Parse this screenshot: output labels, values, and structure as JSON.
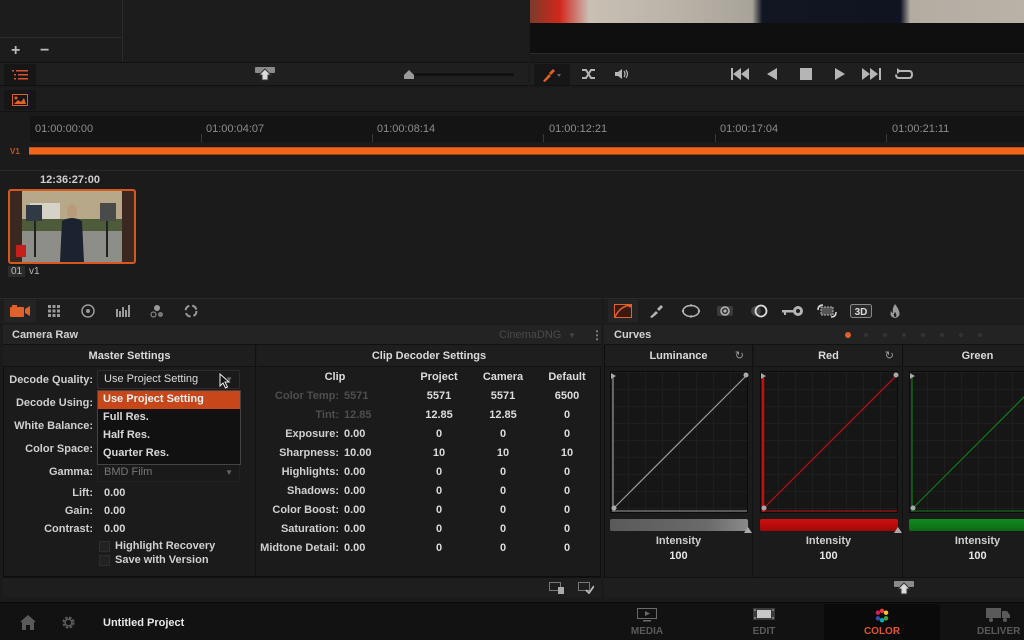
{
  "media_pool": {
    "add_label": "+",
    "remove_label": "−"
  },
  "viewer_controls": {
    "icons": [
      "eyedropper-icon",
      "shuffle-icon",
      "volume-icon",
      "skip-back-icon",
      "play-reverse-icon",
      "stop-icon",
      "play-icon",
      "skip-forward-icon",
      "loop-icon"
    ]
  },
  "timeline": {
    "timecodes": [
      "01:00:00:00",
      "01:00:04:07",
      "01:00:08:14",
      "01:00:12:21",
      "01:00:17:04",
      "01:00:21:11"
    ],
    "track_label": "V1"
  },
  "clip": {
    "timecode": "12:36:27:00",
    "number": "01",
    "track": "v1"
  },
  "left_palette_icons": [
    "camera-raw-icon",
    "grid-icon",
    "primaries-icon",
    "rgb-mixer-icon",
    "nodes-icon",
    "motion-icon"
  ],
  "right_palette_icons": [
    "curves-icon",
    "qualifier-icon",
    "window-icon",
    "tracker-icon",
    "blur-icon",
    "key-icon",
    "sizing-icon",
    "3d-icon",
    "fire-icon"
  ],
  "camera_raw": {
    "title": "Camera Raw",
    "codec": "CinemaDNG",
    "master_settings": {
      "header": "Master Settings",
      "decode_quality_label": "Decode Quality:",
      "decode_quality_value": "Use Project Setting",
      "decode_using_label": "Decode Using:",
      "white_balance_label": "White Balance:",
      "color_space_label": "Color Space:",
      "gamma_label": "Gamma:",
      "gamma_value": "BMD Film",
      "lift_label": "Lift:",
      "lift_value": "0.00",
      "gain_label": "Gain:",
      "gain_value": "0.00",
      "contrast_label": "Contrast:",
      "contrast_value": "0.00",
      "highlight_recovery_label": "Highlight Recovery",
      "save_with_version_label": "Save with Version",
      "dropdown_options": [
        "Use Project Setting",
        "Full Res.",
        "Half Res.",
        "Quarter Res."
      ],
      "dropdown_selected": "Use Project Setting"
    },
    "clip_decoder": {
      "header": "Clip Decoder Settings",
      "columns": [
        "Clip",
        "Project",
        "Camera",
        "Default"
      ],
      "rows": [
        {
          "label": "Color Temp:",
          "clip": "5571",
          "project": "5571",
          "camera": "5571",
          "default": "6500",
          "disabled": true
        },
        {
          "label": "Tint:",
          "clip": "12.85",
          "project": "12.85",
          "camera": "12.85",
          "default": "0",
          "disabled": true
        },
        {
          "label": "Exposure:",
          "clip": "0.00",
          "project": "0",
          "camera": "0",
          "default": "0",
          "disabled": false
        },
        {
          "label": "Sharpness:",
          "clip": "10.00",
          "project": "10",
          "camera": "10",
          "default": "10",
          "disabled": false
        },
        {
          "label": "Highlights:",
          "clip": "0.00",
          "project": "0",
          "camera": "0",
          "default": "0",
          "disabled": false
        },
        {
          "label": "Shadows:",
          "clip": "0.00",
          "project": "0",
          "camera": "0",
          "default": "0",
          "disabled": false
        },
        {
          "label": "Color Boost:",
          "clip": "0.00",
          "project": "0",
          "camera": "0",
          "default": "0",
          "disabled": false
        },
        {
          "label": "Saturation:",
          "clip": "0.00",
          "project": "0",
          "camera": "0",
          "default": "0",
          "disabled": false
        },
        {
          "label": "Midtone Detail:",
          "clip": "0.00",
          "project": "0",
          "camera": "0",
          "default": "0",
          "disabled": false
        }
      ]
    }
  },
  "curves": {
    "title": "Curves",
    "page_count": 8,
    "active_page": 1,
    "channels": [
      {
        "name": "Luminance",
        "intensity_label": "Intensity",
        "intensity": "100",
        "color": "#9a9a9a",
        "has_reset": true
      },
      {
        "name": "Red",
        "intensity_label": "Intensity",
        "intensity": "100",
        "color": "#c01010",
        "has_reset": true
      },
      {
        "name": "Green",
        "intensity_label": "Intensity",
        "intensity": "100",
        "color": "#0f7a1a",
        "has_reset": false
      }
    ]
  },
  "bottom_nav": {
    "project_name": "Untitled Project",
    "pages": [
      {
        "label": "MEDIA",
        "active": false
      },
      {
        "label": "EDIT",
        "active": false
      },
      {
        "label": "COLOR",
        "active": true
      },
      {
        "label": "DELIVER",
        "active": false
      }
    ]
  },
  "accent_color": "#e1542a"
}
